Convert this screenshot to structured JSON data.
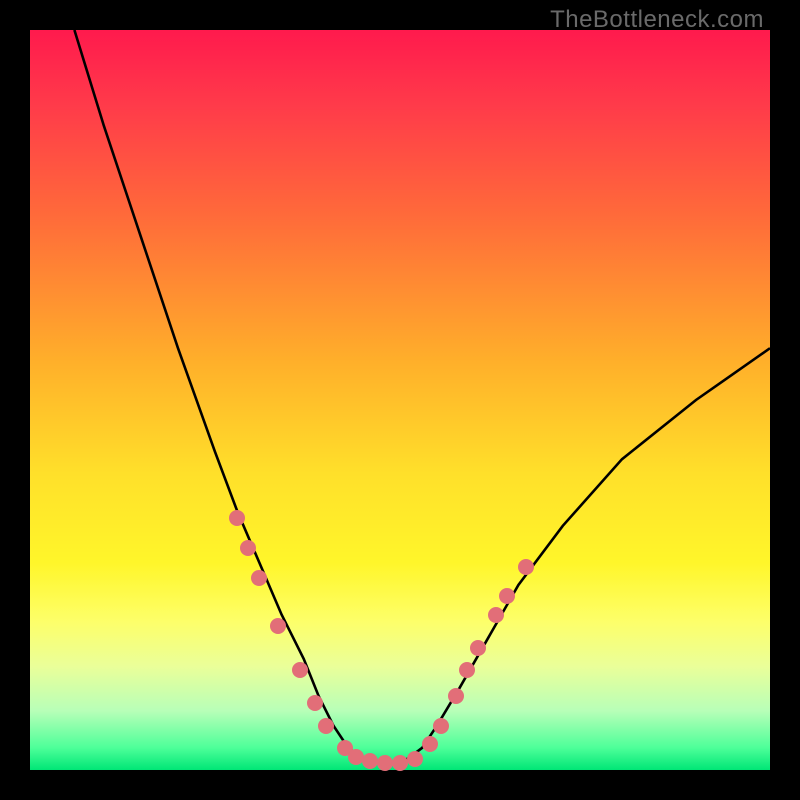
{
  "watermark": "TheBottleneck.com",
  "colors": {
    "frame": "#000000",
    "curve": "#000000",
    "dot": "#e26e78"
  },
  "chart_data": {
    "type": "line",
    "title": "",
    "xlabel": "",
    "ylabel": "",
    "xlim": [
      0,
      100
    ],
    "ylim": [
      0,
      100
    ],
    "note": "Axes are implied (no tick labels rendered). Values below are percentages of plot width/height, read by estimating positions against the square plot area. y is distance from the bottom edge.",
    "series": [
      {
        "name": "bottleneck-curve",
        "x": [
          6,
          10,
          15,
          20,
          25,
          28,
          31,
          34,
          37,
          39,
          41,
          43,
          45,
          47,
          49,
          51,
          53,
          55,
          58,
          62,
          66,
          72,
          80,
          90,
          100
        ],
        "y": [
          100,
          87,
          72,
          57,
          43,
          35,
          28,
          21,
          15,
          10,
          6,
          3,
          1.5,
          1,
          1,
          1.5,
          3,
          6,
          11,
          18,
          25,
          33,
          42,
          50,
          57
        ]
      }
    ],
    "markers": {
      "name": "highlight-dots",
      "note": "Salmon circular markers overlaid on the curve near the trough region.",
      "points": [
        {
          "x": 28.0,
          "y": 34.0
        },
        {
          "x": 29.5,
          "y": 30.0
        },
        {
          "x": 31.0,
          "y": 26.0
        },
        {
          "x": 33.5,
          "y": 19.5
        },
        {
          "x": 36.5,
          "y": 13.5
        },
        {
          "x": 38.5,
          "y": 9.0
        },
        {
          "x": 40.0,
          "y": 6.0
        },
        {
          "x": 42.5,
          "y": 3.0
        },
        {
          "x": 44.0,
          "y": 1.8
        },
        {
          "x": 46.0,
          "y": 1.2
        },
        {
          "x": 48.0,
          "y": 1.0
        },
        {
          "x": 50.0,
          "y": 1.0
        },
        {
          "x": 52.0,
          "y": 1.5
        },
        {
          "x": 54.0,
          "y": 3.5
        },
        {
          "x": 55.5,
          "y": 6.0
        },
        {
          "x": 57.5,
          "y": 10.0
        },
        {
          "x": 59.0,
          "y": 13.5
        },
        {
          "x": 60.5,
          "y": 16.5
        },
        {
          "x": 63.0,
          "y": 21.0
        },
        {
          "x": 64.5,
          "y": 23.5
        },
        {
          "x": 67.0,
          "y": 27.5
        }
      ]
    }
  }
}
